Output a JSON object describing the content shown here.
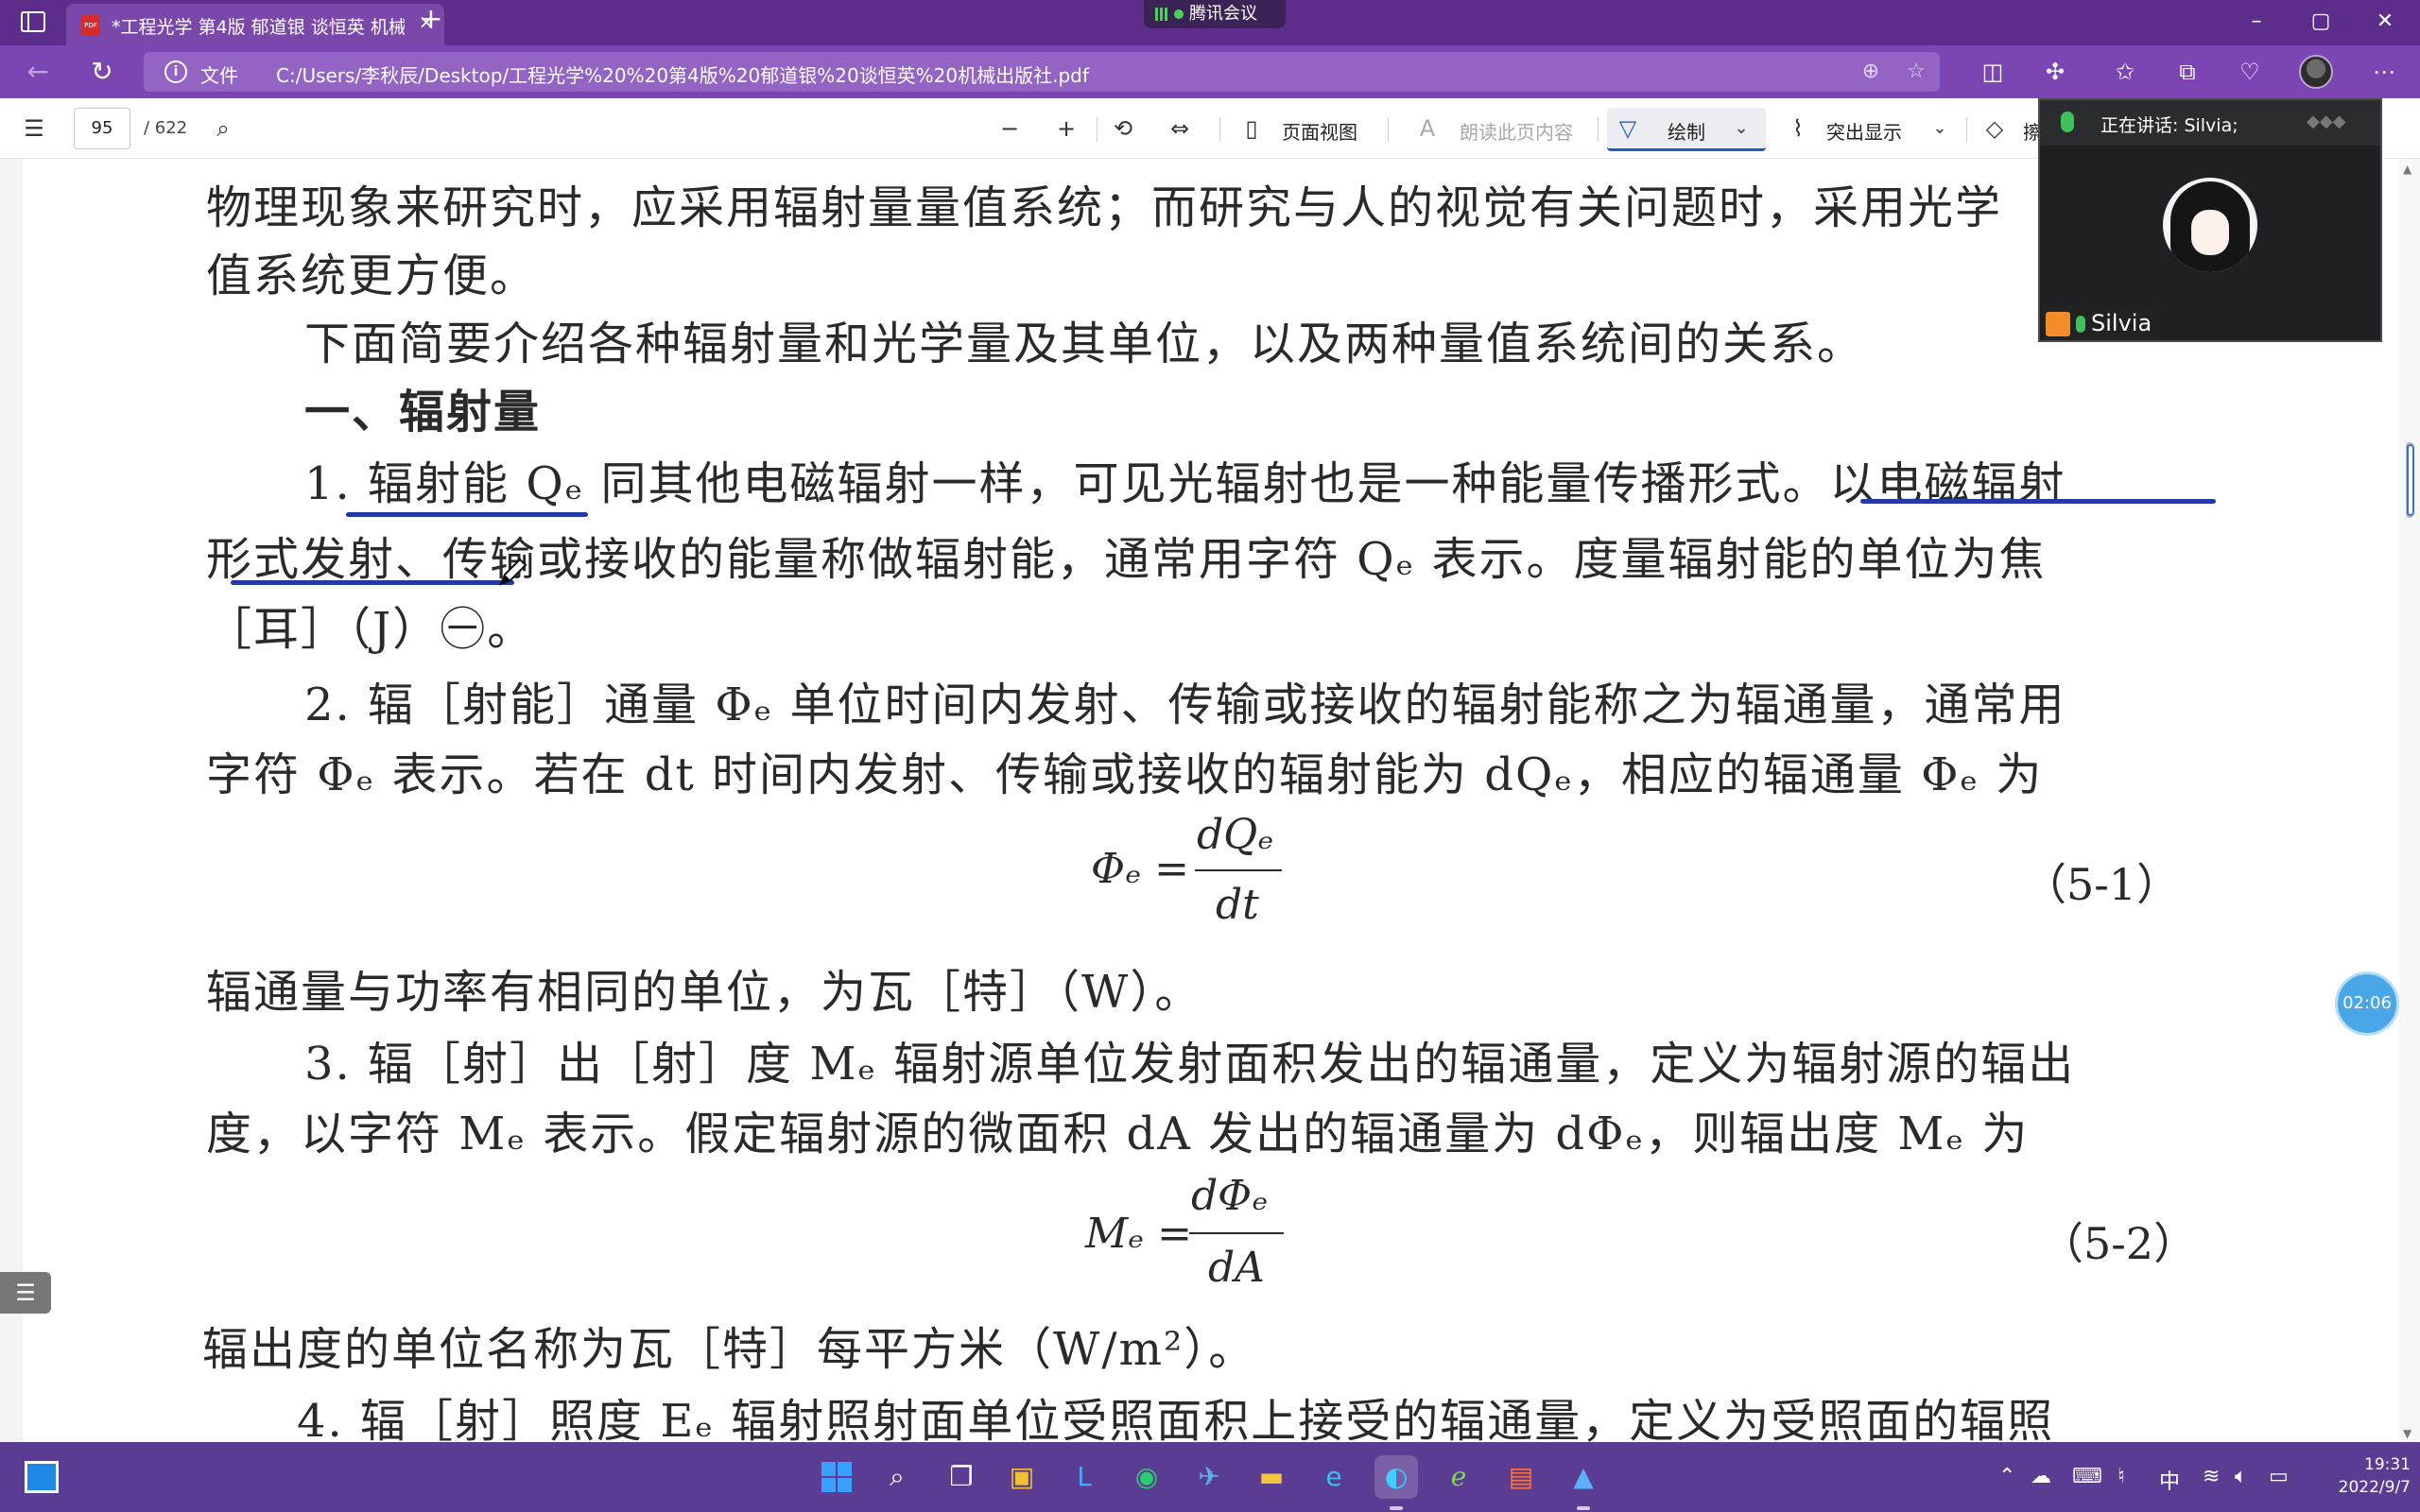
{
  "window": {
    "tab_title": "*工程光学 第4版 郁道银 谈恒英 机械",
    "tab_close": "×",
    "new_tab": "+",
    "meeting_app": "腾讯会议",
    "minimize": "–",
    "maximize": "▢",
    "close": "✕"
  },
  "address_bar": {
    "scheme_label": "文件",
    "url": "C:/Users/李秋辰/Desktop/工程光学%20%20第4版%20郁道银%20谈恒英%20机械出版社.pdf"
  },
  "pdf_toolbar": {
    "page_current": "95",
    "page_total": "/ 622",
    "zoom_out": "−",
    "zoom_in": "+",
    "page_view": "页面视图",
    "read_aloud": "朗读此页内容",
    "draw": "绘制",
    "highlight": "突出显示",
    "erase": "擦"
  },
  "document": {
    "lines": [
      "物理现象来研究时，应采用辐射量量值系统；而研究与人的视觉有关问题时，采用光学",
      "值系统更方便。",
      "下面简要介绍各种辐射量和光学量及其单位，以及两种量值系统间的关系。",
      "一、辐射量",
      "1.  辐射能 Qₑ   同其他电磁辐射一样，可见光辐射也是一种能量传播形式。以电磁辐射",
      "形式发射、传输或接收的能量称做辐射能，通常用字符 Qₑ 表示。度量辐射能的单位为焦",
      "［耳］（J）㊀。",
      "2.  辐［射能］通量 Φₑ   单位时间内发射、传输或接收的辐射能称之为辐通量，通常用",
      "字符 Φₑ 表示。若在 dt 时间内发射、传输或接收的辐射能为 dQₑ，相应的辐通量 Φₑ 为",
      "辐通量与功率有相同的单位，为瓦［特］（W）。",
      "3.  辐［射］出［射］度 Mₑ   辐射源单位发射面积发出的辐通量，定义为辐射源的辐出",
      "度，以字符 Mₑ 表示。假定辐射源的微面积 dA 发出的辐通量为 dΦₑ，则辐出度 Mₑ 为",
      "辐出度的单位名称为瓦［特］每平方米（W/m²）。",
      "4.  辐［射］照度 Eₑ   辐射照射面单位受照面积上接受的辐通量，定义为受照面的辐照"
    ],
    "eq1": {
      "lhs": "Φₑ =",
      "num": "dQₑ",
      "den": "dt",
      "number": "（5-1）"
    },
    "eq2": {
      "lhs": "Mₑ =",
      "num": "dΦₑ",
      "den": "dA",
      "number": "（5-2）"
    }
  },
  "meeting": {
    "speaking_label": "正在讲话: Silvia;",
    "participant": "Silvia",
    "timer": "02:06"
  },
  "taskbar": {
    "ime": "中",
    "time": "19:31",
    "date": "2022/9/7"
  },
  "colors": {
    "titlebar": "#5d2d8c",
    "addressbar": "#7b45b3",
    "taskbar": "#5b3c93",
    "ink": "#2339a8",
    "timer": "#49a7e8"
  }
}
